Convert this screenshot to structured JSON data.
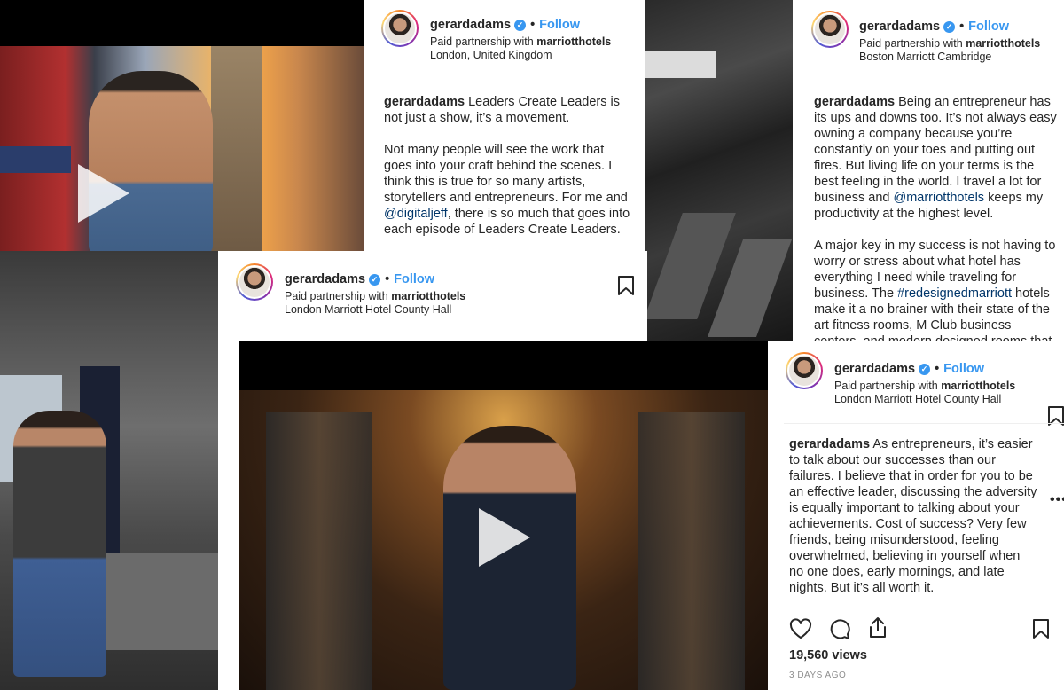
{
  "posts": [
    {
      "username": "gerardadams",
      "follow_label": "Follow",
      "partnership_prefix": "Paid partnership with",
      "partner": "marriotthotels",
      "location": "London, United Kingdom",
      "caption_p1": "Leaders Create Leaders is not just a show, it’s a movement.",
      "caption_p2_a": "Not many people will see the work that goes into your craft behind the scenes. I think this is true for so many artists, storytellers and entrepreneurs. For me and ",
      "caption_p2_mention": "@digitaljeff",
      "caption_p2_b": ", there is so much that goes into each episode of Leaders Create Leaders."
    },
    {
      "username": "gerardadams",
      "follow_label": "Follow",
      "partnership_prefix": "Paid partnership with",
      "partner": "marriotthotels",
      "location": "Boston Marriott Cambridge",
      "caption_p1_a": "Being an entrepreneur has its ups and downs too. It’s not always easy owning a company because you’re constantly on your toes and putting out fires. But living life on your terms is the best feeling in the world. I travel a lot for business and ",
      "caption_p1_mention": "@marriotthotels",
      "caption_p1_b": " keeps my productivity at the highest level.",
      "caption_p2_a": "A major key in my success is not having to worry or stress about what hotel has everything I need while traveling for business. The ",
      "caption_p2_mention": "#redesignedmarriott",
      "caption_p2_b": " hotels make it a no brainer with their state of the art fitness rooms, M Club business centers, and modern designed rooms that"
    },
    {
      "username": "gerardadams",
      "follow_label": "Follow",
      "partnership_prefix": "Paid partnership with",
      "partner": "marriotthotels",
      "location": "London Marriott Hotel County Hall"
    },
    {
      "username": "gerardadams",
      "follow_label": "Follow",
      "partnership_prefix": "Paid partnership with",
      "partner": "marriotthotels",
      "location": "London Marriott Hotel County Hall",
      "caption": "As entrepreneurs, it’s easier to talk about our successes than our failures. I believe that in order for you to be an effective leader, discussing the adversity is equally important to talking about your achievements. Cost of success? Very few friends, being misunderstood, feeling overwhelmed, believing in yourself when no one does, early mornings, and late nights. But it’s all worth it.",
      "views": "19,560 views",
      "timestamp": "3 DAYS AGO"
    }
  ],
  "icons": [
    "play-icon",
    "bookmark-icon",
    "heart-icon",
    "comment-icon",
    "share-icon",
    "more-icon",
    "verified-icon"
  ],
  "colors": {
    "link": "#3897f0",
    "mention": "#003569",
    "text": "#262626",
    "muted": "#8e8e8e"
  }
}
